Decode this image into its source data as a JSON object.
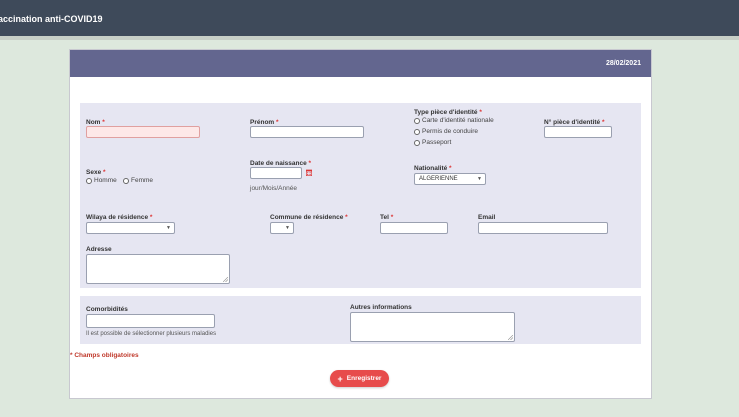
{
  "app": {
    "title": "accination anti-COVID19"
  },
  "header": {
    "date": "28/02/2021"
  },
  "identity": {
    "nom_label": "Nom",
    "prenom_label": "Prénom",
    "type_piece_label": "Type pièce d'identité",
    "type_piece_options": [
      "Carte d'identité nationale",
      "Permis de conduire",
      "Passeport"
    ],
    "num_piece_label": "N° pièce d'identité",
    "sexe_label": "Sexe",
    "sexe_options": [
      "Homme",
      "Femme"
    ],
    "dob_label": "Date de naissance",
    "dob_hint": "jour/Mois/Année",
    "nationalite_label": "Nationalité",
    "nationalite_value": "ALGERIENNE"
  },
  "contact": {
    "wilaya_label": "Wilaya de résidence",
    "commune_label": "Commune de résidence",
    "tel_label": "Tel",
    "email_label": "Email",
    "adresse_label": "Adresse"
  },
  "medical": {
    "comorbidites_label": "Comorbidités",
    "comorbidites_hint": "Il est possible de sélectionner plusieurs maladies",
    "autres_label": "Autres informations"
  },
  "required_marker": "*",
  "required_note": "* Champs obligatoires",
  "save_label": "Enregistrer",
  "save_icon": "plus-icon",
  "colors": {
    "header": "#63668f",
    "topbar": "#3e4a5a",
    "save": "#e74c4c",
    "required": "#d33333",
    "panel": "#e6e6f2"
  }
}
